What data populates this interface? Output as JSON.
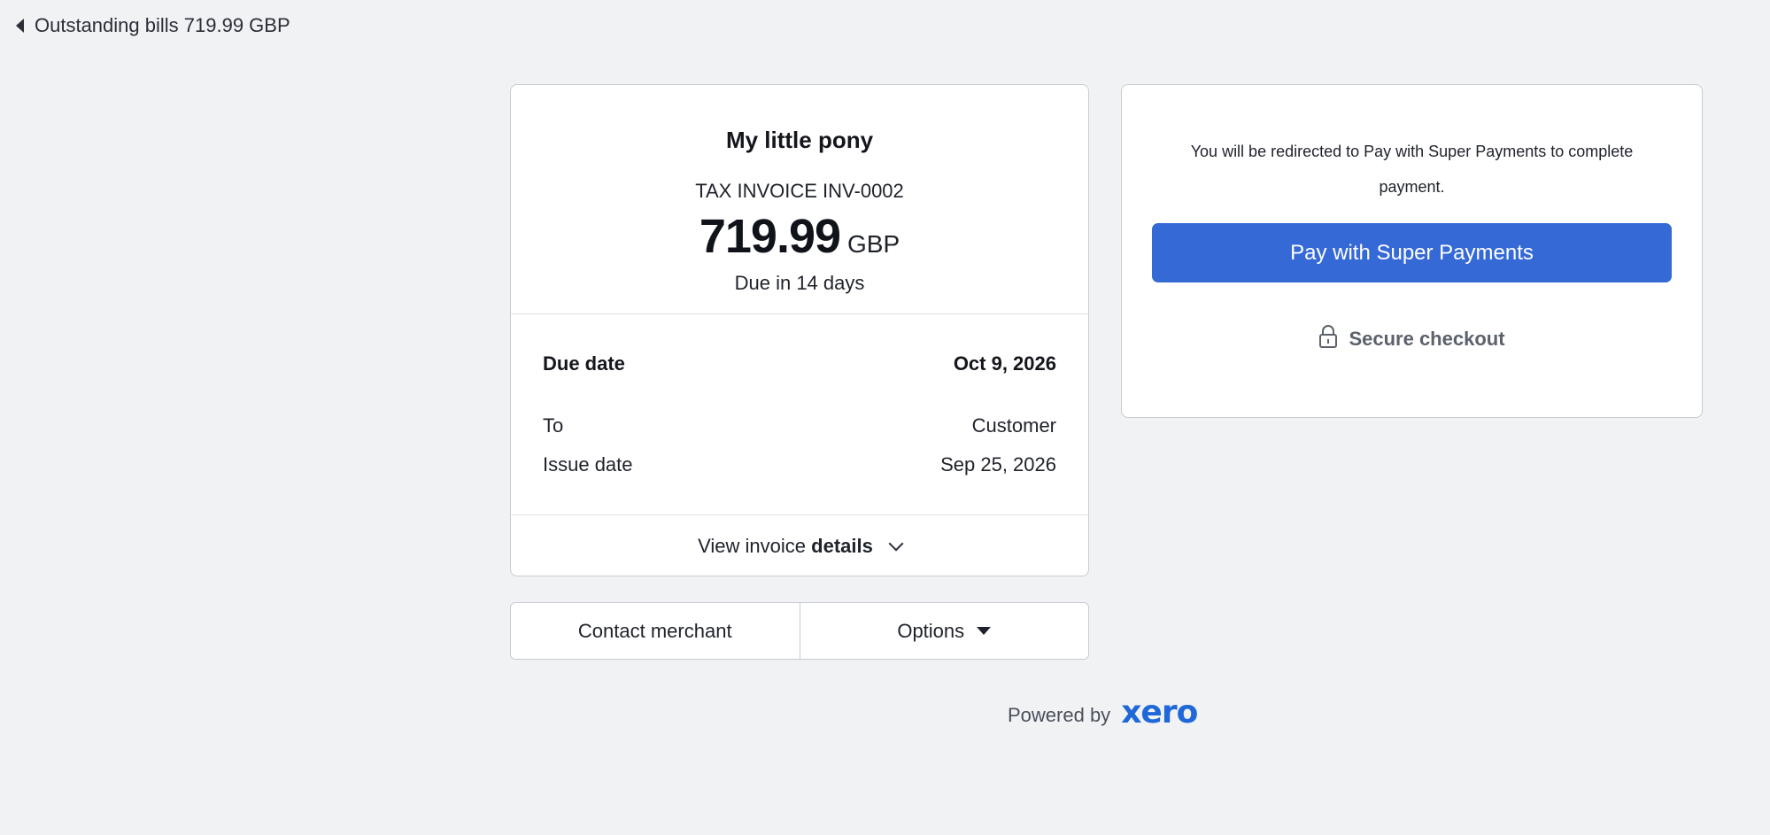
{
  "header": {
    "back_label": "Outstanding bills 719.99 GBP"
  },
  "invoice": {
    "merchant_name": "My little pony",
    "invoice_label": "TAX INVOICE INV-0002",
    "amount": "719.99",
    "currency": "GBP",
    "due_in": "Due in 14 days",
    "rows": {
      "due_date_label": "Due date",
      "due_date_value": "Oct 9, 2026",
      "to_label": "To",
      "to_value": "Customer",
      "issue_date_label": "Issue date",
      "issue_date_value": "Sep 25, 2026"
    },
    "view_details_prefix": "View invoice",
    "view_details_bold": "details"
  },
  "actions": {
    "contact_label": "Contact merchant",
    "options_label": "Options"
  },
  "footer": {
    "powered_by": "Powered by",
    "brand": "xero"
  },
  "payment": {
    "redirect_text": "You will be redirected to Pay with Super Payments to complete payment.",
    "pay_button_label": "Pay with Super Payments",
    "secure_label": "Secure checkout"
  },
  "colors": {
    "page_bg": "#f1f2f4",
    "primary_button": "#3569d6",
    "brand_blue": "#1f68d8"
  },
  "icons": [
    "back-caret-icon",
    "chevron-down-icon",
    "caret-down-icon",
    "lock-icon"
  ]
}
